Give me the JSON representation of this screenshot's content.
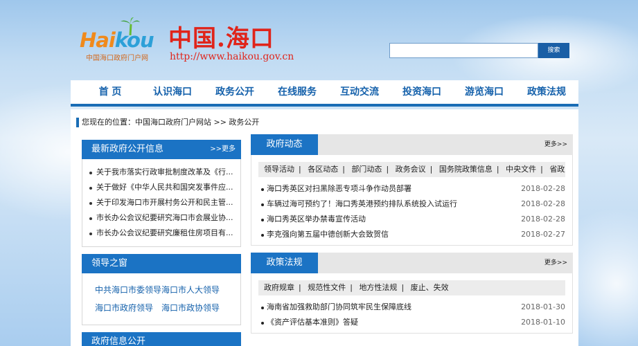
{
  "header": {
    "logo_wordmark_hai": "Hai",
    "logo_wordmark_kou": "kou",
    "logo_subtitle": "中国海口政府门户网",
    "site_title": "中国.海口",
    "site_url": "http://www.haikou.gov.cn",
    "search_placeholder": "",
    "search_button": "搜索"
  },
  "nav": [
    "首 页",
    "认识海口",
    "政务公开",
    "在线服务",
    "互动交流",
    "投资海口",
    "游览海口",
    "政策法规"
  ],
  "breadcrumb": "您现在的位置：中国海口政府门户网站 >> 政务公开",
  "left": {
    "latest": {
      "title": "最新政府公开信息",
      "more": ">>更多",
      "items": [
        "关于我市落实行政审批制度改革及《行...",
        "关于做好《中华人民共和国突发事件应...",
        "关于印发海口市开展村务公开和民主管...",
        "市长办公会议纪要研究海口市会展业协...",
        "市长办公会议纪要研究廉租住房项目有..."
      ]
    },
    "leaders": {
      "title": "领导之窗",
      "links": [
        "中共海口市委领导",
        "海口市人大领导",
        "海口市政府领导",
        "海口市政协领导"
      ]
    },
    "info": {
      "title": "政府信息公开"
    }
  },
  "right": {
    "news": {
      "title": "政府动态",
      "more": "更多>>",
      "tabs": [
        "领导活动",
        "各区动态",
        "部门动态",
        "政务会议",
        "国务院政策信息",
        "中央文件",
        "省政府文件"
      ],
      "items": [
        {
          "text": "海口秀英区对扫黑除恶专项斗争作动员部署",
          "date": "2018-02-28"
        },
        {
          "text": "车辆过海可预约了！海口秀英港预约排队系统投入试运行",
          "date": "2018-02-28"
        },
        {
          "text": "海口秀英区举办禁毒宣传活动",
          "date": "2018-02-28"
        },
        {
          "text": "李克强向第五届中德创新大会致贺信",
          "date": "2018-02-27"
        }
      ]
    },
    "policy": {
      "title": "政策法规",
      "more": "更多>>",
      "tabs": [
        "政府规章",
        "规范性文件",
        "地方性法规",
        "废止、失效"
      ],
      "items": [
        {
          "text": "海南省加强救助部门协同筑牢民生保障底线",
          "date": "2018-01-30"
        },
        {
          "text": "《资产评估基本准则》答疑",
          "date": "2018-01-10"
        }
      ]
    }
  }
}
